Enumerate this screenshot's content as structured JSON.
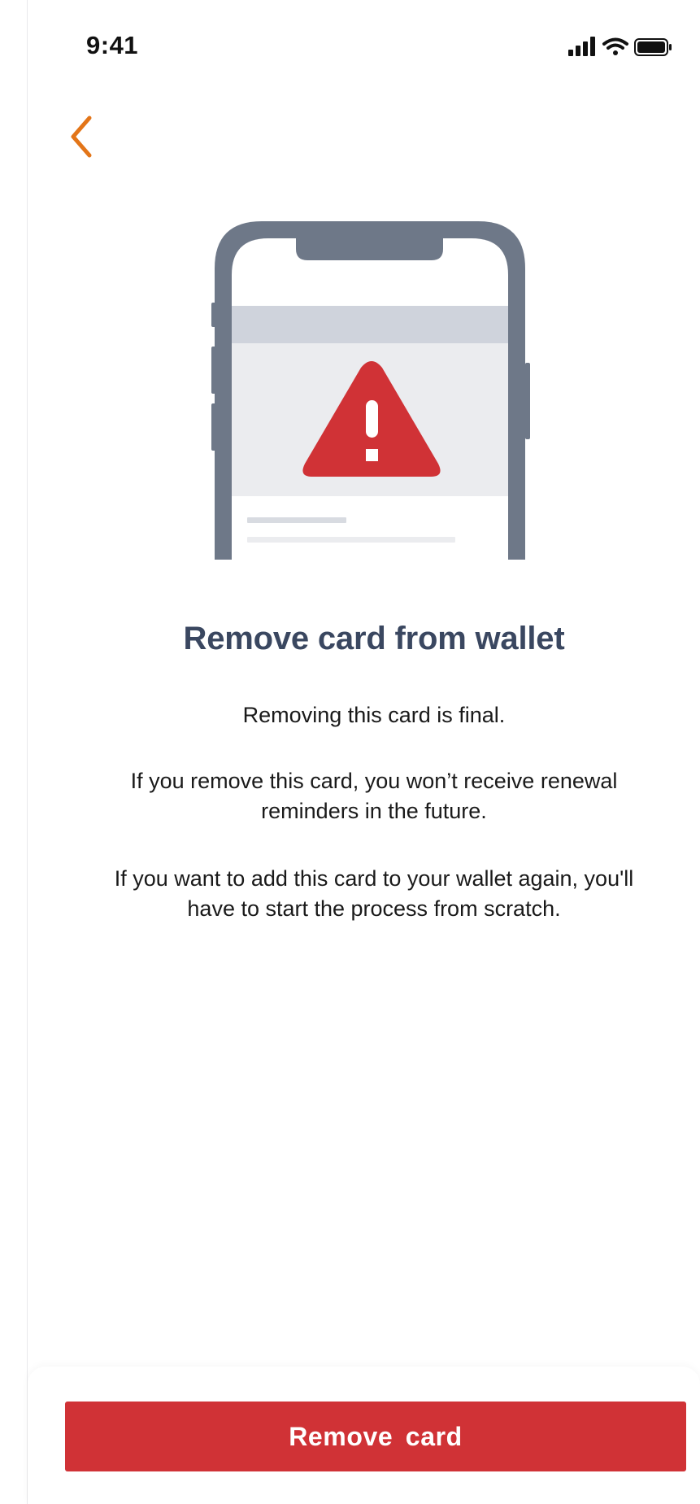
{
  "status_bar": {
    "time": "9:41",
    "icons": [
      "signal-icon",
      "wifi-icon",
      "battery-icon"
    ]
  },
  "navigation": {
    "back_icon": "chevron-left-icon",
    "back_color": "#E37518"
  },
  "illustration": {
    "icon": "warning-triangle-icon",
    "warning_color": "#D03236",
    "phone_color": "#6E7888"
  },
  "content": {
    "title": "Remove card from wallet",
    "paragraphs": [
      "Removing this card is final.",
      "If you remove this card, you won’t receive renewal reminders in the future.",
      "If you want to add this card to your wallet again, you'll have to start the process from scratch."
    ]
  },
  "actions": {
    "remove_label": "Remove  card",
    "remove_color": "#D03236"
  }
}
